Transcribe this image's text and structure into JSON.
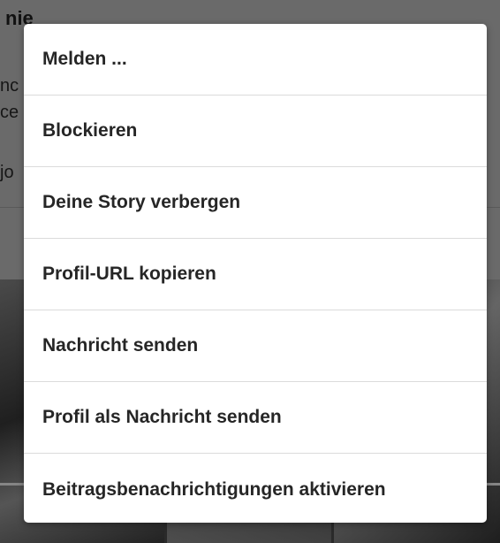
{
  "background": {
    "profile_name_fragment": "nie",
    "text_fragments": [
      "nc",
      "ce",
      "jo"
    ]
  },
  "menu": {
    "items": [
      {
        "label": "Melden ..."
      },
      {
        "label": "Blockieren"
      },
      {
        "label": "Deine Story verbergen"
      },
      {
        "label": "Profil-URL kopieren"
      },
      {
        "label": "Nachricht senden"
      },
      {
        "label": "Profil als Nachricht senden"
      },
      {
        "label": "Beitragsbenachrichtigungen aktivieren"
      }
    ]
  },
  "colors": {
    "dialog_background": "#ffffff",
    "text": "#262626",
    "divider": "#dbdbdb",
    "overlay": "#707070"
  }
}
